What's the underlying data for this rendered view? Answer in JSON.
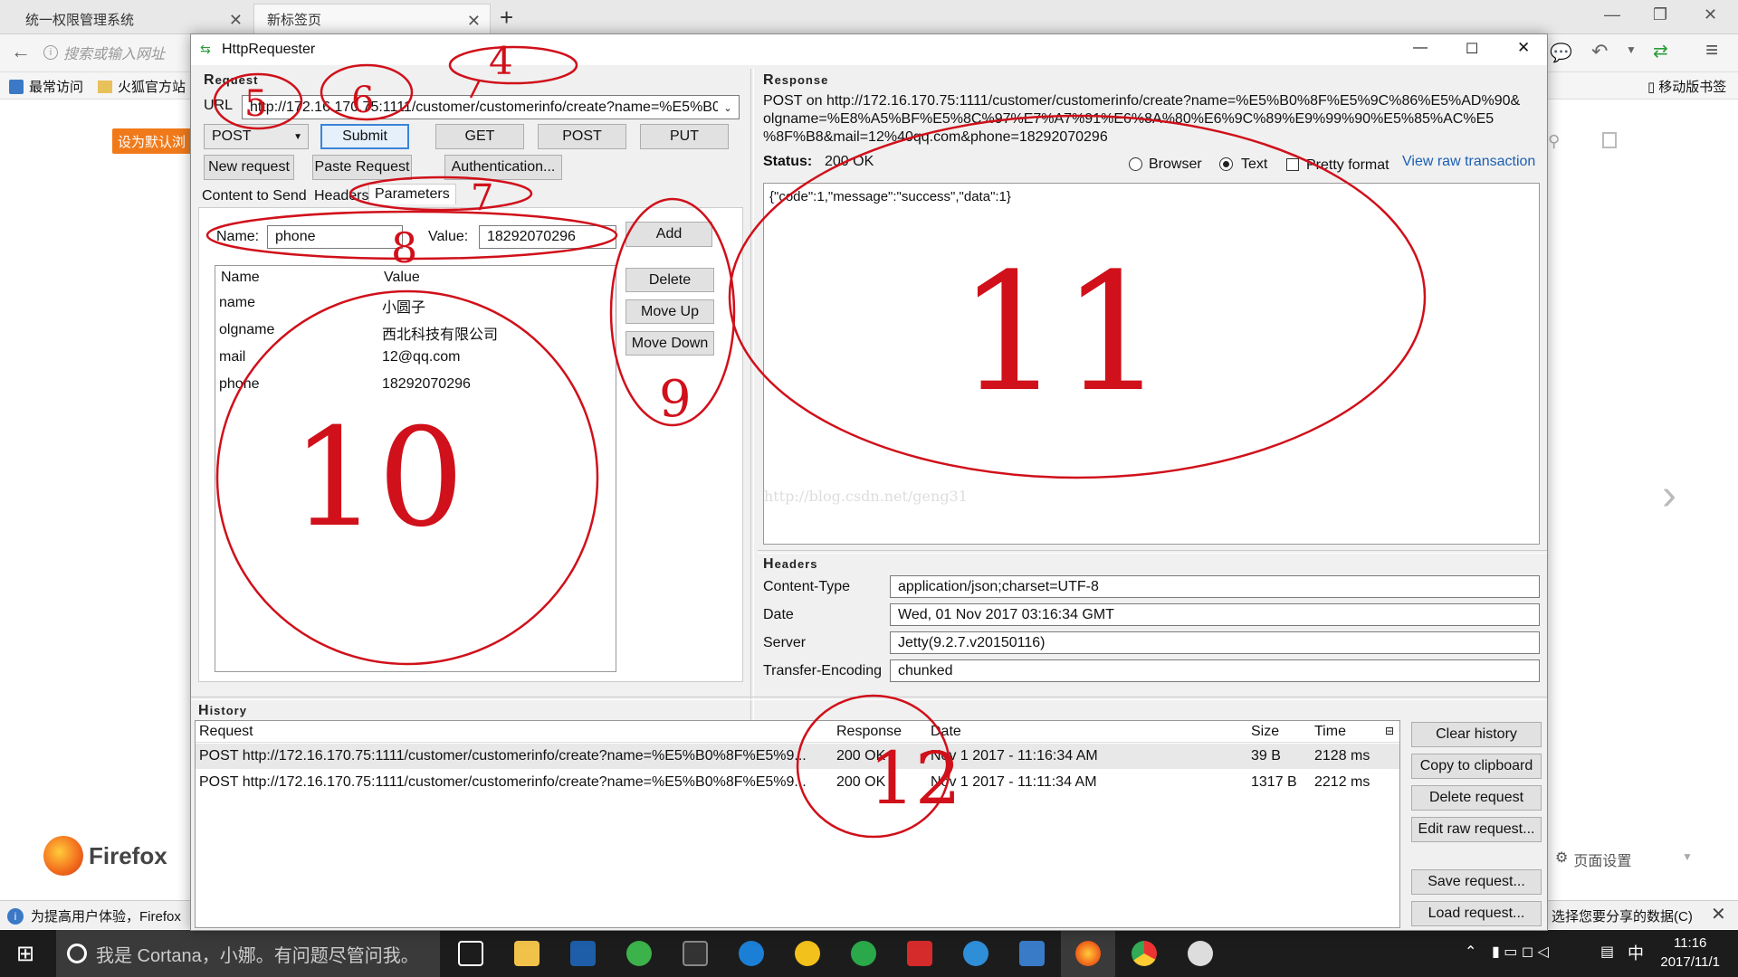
{
  "browser": {
    "tabs": [
      {
        "label": "统一权限管理系统"
      },
      {
        "label": "新标签页"
      }
    ],
    "address_placeholder": "搜索或输入网址",
    "bookmarks": [
      {
        "label": "最常访问"
      },
      {
        "label": "火狐官方站"
      }
    ],
    "mobile_bookmarks": "移动版书签",
    "set_default_button": "设为默认浏",
    "firefox_label": "Firefox",
    "notification": "为提高用户体验，Firefox",
    "share_data_link": "选择您要分享的数据(C)",
    "page_settings": "页面设置"
  },
  "taskbar": {
    "cortana": "我是 Cortana，小娜。有问题尽管问我。",
    "time": "11:16",
    "date": "2017/11/1",
    "ime": "中"
  },
  "app": {
    "title": "HttpRequester",
    "request": {
      "section": "Request",
      "url_label": "URL",
      "url_value": "http://172.16.170.75:1111/customer/customerinfo/create?name=%E5%B0",
      "method": "POST",
      "buttons": {
        "submit": "Submit",
        "get": "GET",
        "post": "POST",
        "put": "PUT",
        "new_request": "New request",
        "paste_request": "Paste Request",
        "authentication": "Authentication..."
      },
      "tabs": {
        "content": "Content to Send",
        "headers": "Headers",
        "parameters": "Parameters"
      },
      "name_label": "Name:",
      "name_value": "phone",
      "value_label": "Value:",
      "value_value": "18292070296",
      "add": "Add",
      "delete": "Delete",
      "move_up": "Move Up",
      "move_down": "Move Down",
      "param_headers": {
        "name": "Name",
        "value": "Value"
      },
      "params": [
        {
          "name": "name",
          "value": "小圆子"
        },
        {
          "name": "olgname",
          "value": "西北科技有限公司"
        },
        {
          "name": "mail",
          "value": "12@qq.com"
        },
        {
          "name": "phone",
          "value": "18292070296"
        }
      ]
    },
    "response": {
      "section": "Response",
      "url_lines": [
        "POST on http://172.16.170.75:1111/customer/customerinfo/create?name=%E5%B0%8F%E5%9C%86%E5%AD%90&",
        "olgname=%E8%A5%BF%E5%8C%97%E7%A7%91%E6%8A%80%E6%9C%89%E9%99%90%E5%85%AC%E5",
        "%8F%B8&mail=12%40qq.com&phone=18292070296"
      ],
      "status_label": "Status:",
      "status_value": "200 OK",
      "view_options": {
        "browser": "Browser",
        "text": "Text",
        "pretty": "Pretty format",
        "raw": "View raw transaction"
      },
      "body": "{\"code\":1,\"message\":\"success\",\"data\":1}",
      "watermark": "http://blog.csdn.net/geng31",
      "headers_section": "Headers",
      "headers": [
        {
          "key": "Content-Type",
          "value": "application/json;charset=UTF-8"
        },
        {
          "key": "Date",
          "value": "Wed, 01 Nov 2017 03:16:34 GMT"
        },
        {
          "key": "Server",
          "value": "Jetty(9.2.7.v20150116)"
        },
        {
          "key": "Transfer-Encoding",
          "value": "chunked"
        }
      ]
    },
    "history": {
      "section": "History",
      "columns": {
        "request": "Request",
        "response": "Response",
        "date": "Date",
        "size": "Size",
        "time": "Time"
      },
      "rows": [
        {
          "request": "POST http://172.16.170.75:1111/customer/customerinfo/create?name=%E5%B0%8F%E5%9...",
          "response": "200 OK",
          "date": "Nov 1 2017 - 11:16:34 AM",
          "size": "39 B",
          "time": "2128 ms"
        },
        {
          "request": "POST http://172.16.170.75:1111/customer/customerinfo/create?name=%E5%B0%8F%E5%9...",
          "response": "200 OK",
          "date": "Nov 1 2017 - 11:11:34 AM",
          "size": "1317 B",
          "time": "2212 ms"
        }
      ],
      "buttons": {
        "clear": "Clear history",
        "copy": "Copy to clipboard",
        "delete": "Delete request",
        "edit": "Edit raw request...",
        "save": "Save request...",
        "load": "Load request..."
      }
    }
  },
  "annotations": [
    "4",
    "5",
    "6",
    "7",
    "8",
    "9",
    "10",
    "11",
    "12"
  ]
}
